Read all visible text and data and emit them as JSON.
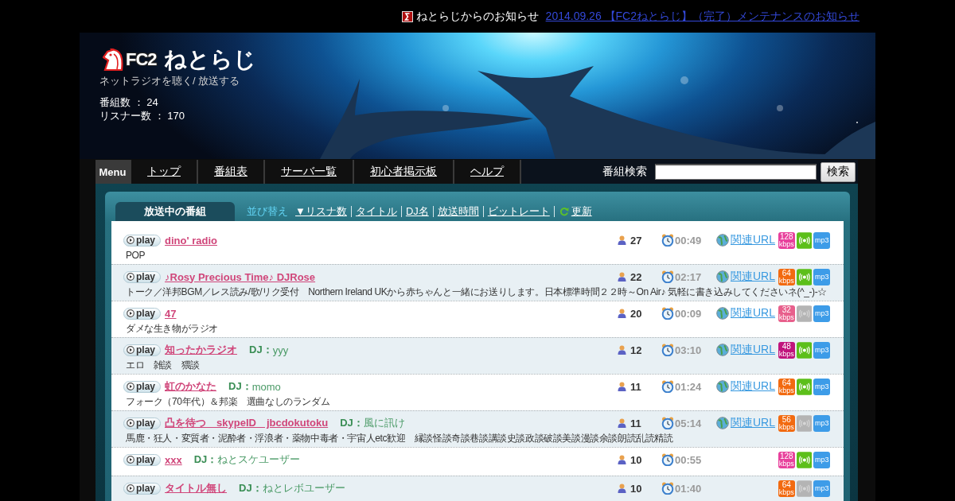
{
  "notice": {
    "label": "ねとらじからのお知らせ",
    "link": "2014.09.26 【FC2ねとらじ】（完了）メンテナンスのお知らせ"
  },
  "header": {
    "logo": {
      "brand": "FC2",
      "name": "ねとらじ"
    },
    "tagline": "ネットラジオを聴く/ 放送する",
    "stats": [
      "番組数 ： 24",
      "リスナー数 ： 170"
    ]
  },
  "menu": {
    "label": "Menu",
    "items": [
      "トップ",
      "番組表",
      "サーバ一覧",
      "初心者掲示板",
      "ヘルプ"
    ]
  },
  "search": {
    "label": "番組検索",
    "button": "検索"
  },
  "tabs": [
    {
      "label": "放送中の番組",
      "selected": true
    }
  ],
  "sort": {
    "label": "並び替え",
    "options": [
      "▼リスナ数",
      "タイトル",
      "DJ名",
      "放送時間",
      "ビットレート"
    ],
    "refresh": "更新"
  },
  "programs": [
    {
      "play": "play",
      "title": "dino' radio",
      "description": "POP",
      "listeners": "27",
      "time": "00:49",
      "link": "関連URL",
      "bitrate": {
        "value": "128",
        "unit": "kbps",
        "color": "#e8409c"
      },
      "signal_on": true,
      "format": "mp3"
    },
    {
      "play": "play",
      "title": "♪Rosy Precious Time♪ DJRose",
      "description": "トーク／洋邦BGM／レス読み/歌/リク受付　Northern Ireland UKから赤ちゃんと一緒にお送りします。日本標準時間２２時～On Air♪ 気軽に書き込みしてくださいネ(^_-)-☆",
      "listeners": "22",
      "time": "02:17",
      "link": "関連URL",
      "bitrate": {
        "value": "64",
        "unit": "kbps",
        "color": "#f26a10"
      },
      "signal_on": true,
      "format": "mp3"
    },
    {
      "play": "play",
      "title": "47",
      "description": "ダメな生き物がラジオ",
      "listeners": "20",
      "time": "00:09",
      "link": "関連URL",
      "bitrate": {
        "value": "32",
        "unit": "kbps",
        "color": "#e8608c"
      },
      "signal_on": false,
      "format": "mp3"
    },
    {
      "play": "play",
      "title": "知ったかラジオ",
      "dj": {
        "label": "DJ：",
        "name": "yyy"
      },
      "description": "エロ　雑談　猥談",
      "listeners": "12",
      "time": "03:10",
      "link": "関連URL",
      "bitrate": {
        "value": "48",
        "unit": "kbps",
        "color": "#c0147c"
      },
      "signal_on": true,
      "format": "mp3"
    },
    {
      "play": "play",
      "title": "虹のかなた",
      "dj": {
        "label": "DJ：",
        "name": "momo"
      },
      "description": "フォーク（70年代）＆邦楽　選曲なしのランダム",
      "listeners": "11",
      "time": "01:24",
      "link": "関連URL",
      "bitrate": {
        "value": "64",
        "unit": "kbps",
        "color": "#f26a10"
      },
      "signal_on": true,
      "format": "mp3"
    },
    {
      "play": "play",
      "title": "凸を待つ　skypeID　jbcdokutoku",
      "dj": {
        "label": "DJ：",
        "name": "風に訊け"
      },
      "description": "馬鹿・狂人・変質者・泥酔者・浮浪者・薬物中毒者・宇宙人etc歓迎　縁談怪談奇談巷談講談史談政談破談美談漫談余談朗読乱読精読",
      "listeners": "11",
      "time": "05:14",
      "link": "関連URL",
      "bitrate": {
        "value": "56",
        "unit": "kbps",
        "color": "#f26a10"
      },
      "signal_on": false,
      "format": "mp3"
    },
    {
      "play": "play",
      "title": "xxx",
      "dj": {
        "label": "DJ：",
        "name": "ねとスケユーザー"
      },
      "listeners": "10",
      "time": "00:55",
      "bitrate": {
        "value": "128",
        "unit": "kbps",
        "color": "#e8409c"
      },
      "signal_on": true,
      "format": "mp3"
    },
    {
      "play": "play",
      "title": "タイトル無し",
      "dj": {
        "label": "DJ：",
        "name": "ねとレボユーザー"
      },
      "listeners": "10",
      "time": "01:40",
      "bitrate": {
        "value": "64",
        "unit": "kbps",
        "color": "#f26a10"
      },
      "signal_on": false,
      "format": "mp3"
    }
  ]
}
